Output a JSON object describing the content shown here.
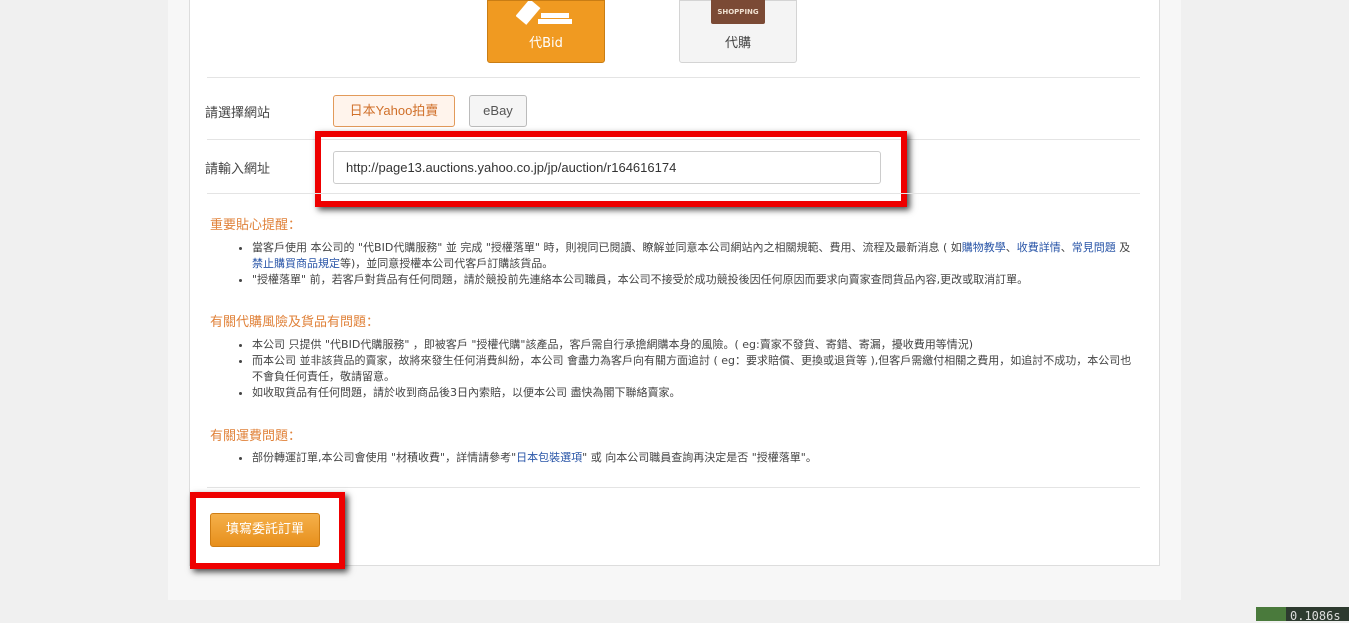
{
  "service_tiles": {
    "bid_label": "代Bid",
    "buy_label": "代購",
    "bag_text": "SHOPPING"
  },
  "site_select": {
    "label": "請選擇網站",
    "options": [
      "日本Yahoo拍賣",
      "eBay"
    ],
    "selected": "日本Yahoo拍賣"
  },
  "url_entry": {
    "label": "請輸入網址",
    "value": "http://page13.auctions.yahoo.co.jp/jp/auction/r164616174"
  },
  "section1": {
    "title": "重要貼心提醒：",
    "item1_a": "當客戶使用 本公司的 \"代BID代購服務\" 並 完成 \"授權落單\" 時，則視同已閱讀、瞭解並同意本公司網站內之相關規範、費用、流程及最新消息 ( 如",
    "item1_link1": "購物教學",
    "item1_sep1": "、",
    "item1_link2": "收費詳情",
    "item1_sep2": "、",
    "item1_link3": "常見問題",
    "item1_and": " 及 ",
    "item1_link4": "禁止購買商品規定",
    "item1_end": "等)，並同意授權本公司代客戶訂購該貨品。",
    "item2": "\"授權落單\" 前，若客戶對貨品有任何問題，請於競投前先連絡本公司職員，本公司不接受於成功競投後因任何原因而要求向賣家查問貨品內容,更改或取消訂單。"
  },
  "section2": {
    "title": "有關代購風險及貨品有問題：",
    "item1": "本公司 只提供 \"代BID代購服務\" ，即被客戶 \"授權代購\"該產品，客戶需自行承擔網購本身的風險。( eg:賣家不發貨、寄錯、寄漏，擾收費用等情況)",
    "item2": "而本公司 並非該貨品的賣家，故將來發生任何消費糾紛，本公司 會盡力為客戶向有關方面追討 ( eg：要求賠償、更換或退貨等 ),但客戶需繳付相關之費用，如追討不成功，本公司也不會負任何責任，敬請留意。",
    "item3": "如收取貨品有任何問題，請於收到商品後3日內索賠，以便本公司 盡快為閣下聯絡賣家。"
  },
  "section3": {
    "title": "有關運費問題：",
    "item1_a": "部份轉運訂單,本公司會使用 \"材積收費\"，詳情請參考\"",
    "item1_link": "日本包裝選項",
    "item1_b": "\" 或 向本公司職員查詢再決定是否 \"授權落單\"。"
  },
  "order_button": "填寫委託訂單",
  "corner_text": "0.1086s"
}
